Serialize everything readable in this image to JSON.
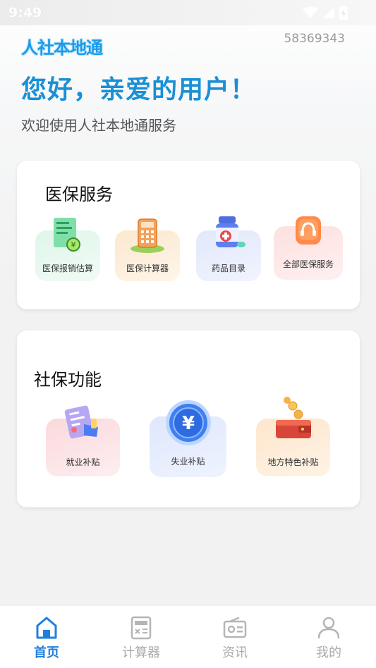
{
  "status_bar": {
    "time": "9:49"
  },
  "header": {
    "app_name": "人社本地通",
    "user_id": "58369343",
    "greeting": "您好，亲爱的用户！",
    "subtitle": "欢迎使用人社本地通服务"
  },
  "medical": {
    "title": "医保服务",
    "items": [
      {
        "label": "医保报销估算",
        "icon": "reimbursement-document-icon"
      },
      {
        "label": "医保计算器",
        "icon": "calculator-icon"
      },
      {
        "label": "药品目录",
        "icon": "medicine-bottle-icon"
      },
      {
        "label": "全部医保服务",
        "icon": "headset-service-icon"
      }
    ]
  },
  "social": {
    "title": "社保功能",
    "items": [
      {
        "label": "就业补贴",
        "icon": "employment-form-icon"
      },
      {
        "label": "失业补贴",
        "icon": "yuan-coin-icon"
      },
      {
        "label": "地方特色补贴",
        "icon": "wallet-coins-icon"
      }
    ]
  },
  "bottom_nav": {
    "items": [
      {
        "label": "首页",
        "icon": "home-icon",
        "active": true
      },
      {
        "label": "计算器",
        "icon": "calculator-icon",
        "active": false
      },
      {
        "label": "资讯",
        "icon": "radio-news-icon",
        "active": false
      },
      {
        "label": "我的",
        "icon": "person-icon",
        "active": false
      }
    ]
  },
  "colors": {
    "accent": "#1a8fd6",
    "nav_active": "#1f7fe0",
    "nav_inactive": "#a9a9a9"
  }
}
